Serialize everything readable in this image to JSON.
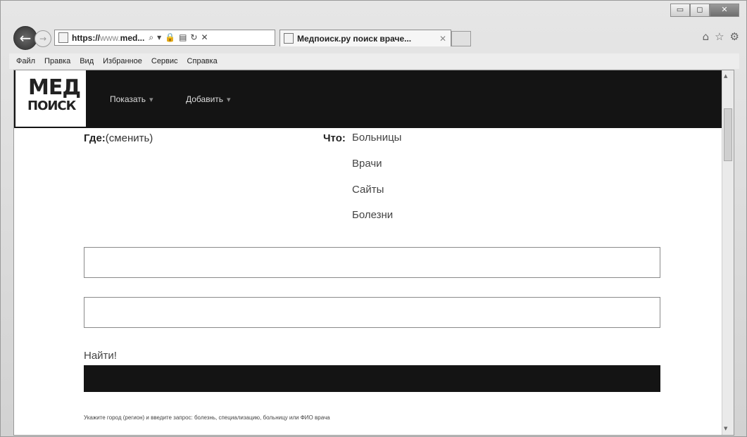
{
  "window": {
    "controls": {
      "minimize": "▭",
      "maximize": "◻",
      "close": "✕"
    }
  },
  "navbar": {
    "back_icon": "←",
    "forward_icon": "→",
    "address": {
      "prefix": "https://",
      "gray": "www.",
      "host": "med...",
      "icons": [
        "⌕",
        "▾",
        "🔒",
        "▤",
        "↻",
        "✕"
      ]
    },
    "tab": {
      "title": "Медпоиск.ру поиск враче...",
      "close": "✕"
    },
    "right_icons": [
      "⌂",
      "☆",
      "⚙"
    ]
  },
  "menubar": {
    "items": [
      "Файл",
      "Правка",
      "Вид",
      "Избранное",
      "Сервис",
      "Справка"
    ]
  },
  "site": {
    "logo": {
      "top": "МЕД",
      "bottom": "ПОИСК"
    },
    "nav": [
      {
        "label": "Показать",
        "caret": "▾"
      },
      {
        "label": "Добавить",
        "caret": "▾"
      }
    ]
  },
  "form": {
    "where_label": "Где:",
    "where_link": "(сменить)",
    "what_label": "Что:",
    "categories": [
      "Больницы",
      "Врачи",
      "Сайты",
      "Болезни"
    ],
    "find_label": "Найти!",
    "hint": "Укажите город (регион) и введите запрос: болезнь, специализацию, больницу или ФИО врача"
  },
  "colors": {
    "header_bg": "#141414",
    "button_bg": "#141414"
  }
}
